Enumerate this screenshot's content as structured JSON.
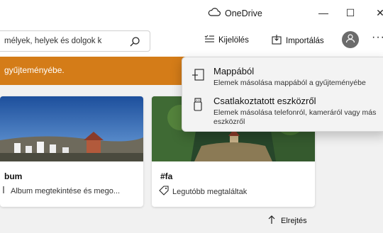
{
  "titlebar": {
    "onedrive_label": "OneDrive",
    "minimize_symbol": "—",
    "maximize_symbol": "☐",
    "close_symbol": "✕"
  },
  "search": {
    "value": "mélyek, helyek és dolgok k",
    "icon": "search-icon"
  },
  "toolbar": {
    "select_label": "Kijelölés",
    "import_label": "Importálás",
    "more_symbol": "···"
  },
  "banner": {
    "text": "gyűjteményébe."
  },
  "cards": [
    {
      "title": "bum",
      "subtitle": "Album megtekintése és mego..."
    },
    {
      "title": "#fa",
      "subtitle": "Legutóbb megtaláltak"
    }
  ],
  "hide_label": "Elrejtés",
  "import_menu": {
    "items": [
      {
        "title": "Mappából",
        "description": "Elemek másolása mappából a gyűjteményébe",
        "icon": "folder-import-icon"
      },
      {
        "title": "Csatlakoztatott eszközről",
        "description": "Elemek másolása telefonról, kameráról vagy más eszközről",
        "icon": "usb-device-icon"
      }
    ]
  },
  "colors": {
    "banner": "#d47c18",
    "content_bg": "#f1f1f1",
    "menu_bg": "#f3f3f3"
  }
}
